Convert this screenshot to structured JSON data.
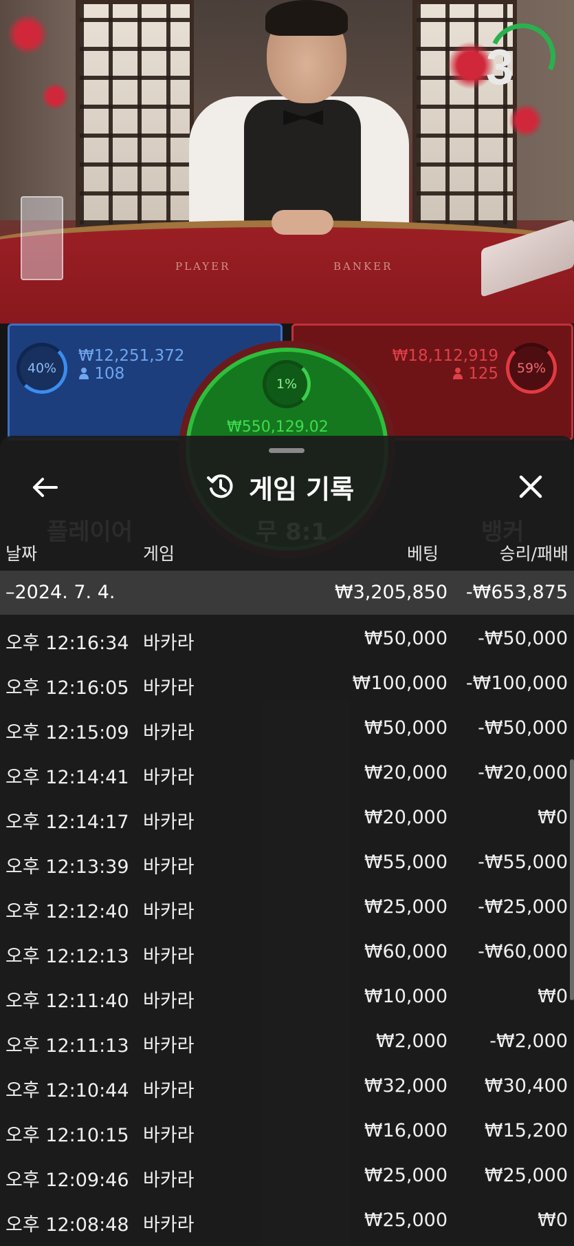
{
  "live": {
    "countdown": "3",
    "felt_player": "PLAYER",
    "felt_banker": "BANKER"
  },
  "bets": {
    "player_percent": "40%",
    "player_amount": "₩12,251,372",
    "player_count": "108",
    "banker_percent": "59%",
    "banker_amount": "₩18,112,919",
    "banker_count": "125",
    "tie_percent": "1%",
    "tie_amount": "₩550,129.02"
  },
  "colors": {
    "player": "#1d3e7c",
    "banker": "#6e1417",
    "tie": "#15781f",
    "sheet": "#1c1c1c",
    "summary_row": "#3a3a3a"
  },
  "sheet": {
    "title": "게임 기록",
    "back_icon": "arrow-left-icon",
    "history_icon": "history-icon",
    "close_icon": "close-icon",
    "ghost": [
      "플레이어",
      "무 8:1",
      "뱅커"
    ],
    "columns": {
      "date": "날짜",
      "game": "게임",
      "bet": "베팅",
      "win_loss": "승리/패배"
    },
    "summary": {
      "date": "–2024. 7. 4.",
      "bet": "₩3,205,850",
      "win_loss": "-₩653,875"
    },
    "rows": [
      {
        "time": "오후 12:16:34",
        "game": "바카라",
        "bet": "₩50,000",
        "win_loss": "-₩50,000"
      },
      {
        "time": "오후 12:16:05",
        "game": "바카라",
        "bet": "₩100,000",
        "win_loss": "-₩100,000"
      },
      {
        "time": "오후 12:15:09",
        "game": "바카라",
        "bet": "₩50,000",
        "win_loss": "-₩50,000"
      },
      {
        "time": "오후 12:14:41",
        "game": "바카라",
        "bet": "₩20,000",
        "win_loss": "-₩20,000"
      },
      {
        "time": "오후 12:14:17",
        "game": "바카라",
        "bet": "₩20,000",
        "win_loss": "₩0"
      },
      {
        "time": "오후 12:13:39",
        "game": "바카라",
        "bet": "₩55,000",
        "win_loss": "-₩55,000"
      },
      {
        "time": "오후 12:12:40",
        "game": "바카라",
        "bet": "₩25,000",
        "win_loss": "-₩25,000"
      },
      {
        "time": "오후 12:12:13",
        "game": "바카라",
        "bet": "₩60,000",
        "win_loss": "-₩60,000"
      },
      {
        "time": "오후 12:11:40",
        "game": "바카라",
        "bet": "₩10,000",
        "win_loss": "₩0"
      },
      {
        "time": "오후 12:11:13",
        "game": "바카라",
        "bet": "₩2,000",
        "win_loss": "-₩2,000"
      },
      {
        "time": "오후 12:10:44",
        "game": "바카라",
        "bet": "₩32,000",
        "win_loss": "₩30,400"
      },
      {
        "time": "오후 12:10:15",
        "game": "바카라",
        "bet": "₩16,000",
        "win_loss": "₩15,200"
      },
      {
        "time": "오후 12:09:46",
        "game": "바카라",
        "bet": "₩25,000",
        "win_loss": "₩25,000"
      },
      {
        "time": "오후 12:08:48",
        "game": "바카라",
        "bet": "₩25,000",
        "win_loss": "₩0"
      }
    ]
  }
}
